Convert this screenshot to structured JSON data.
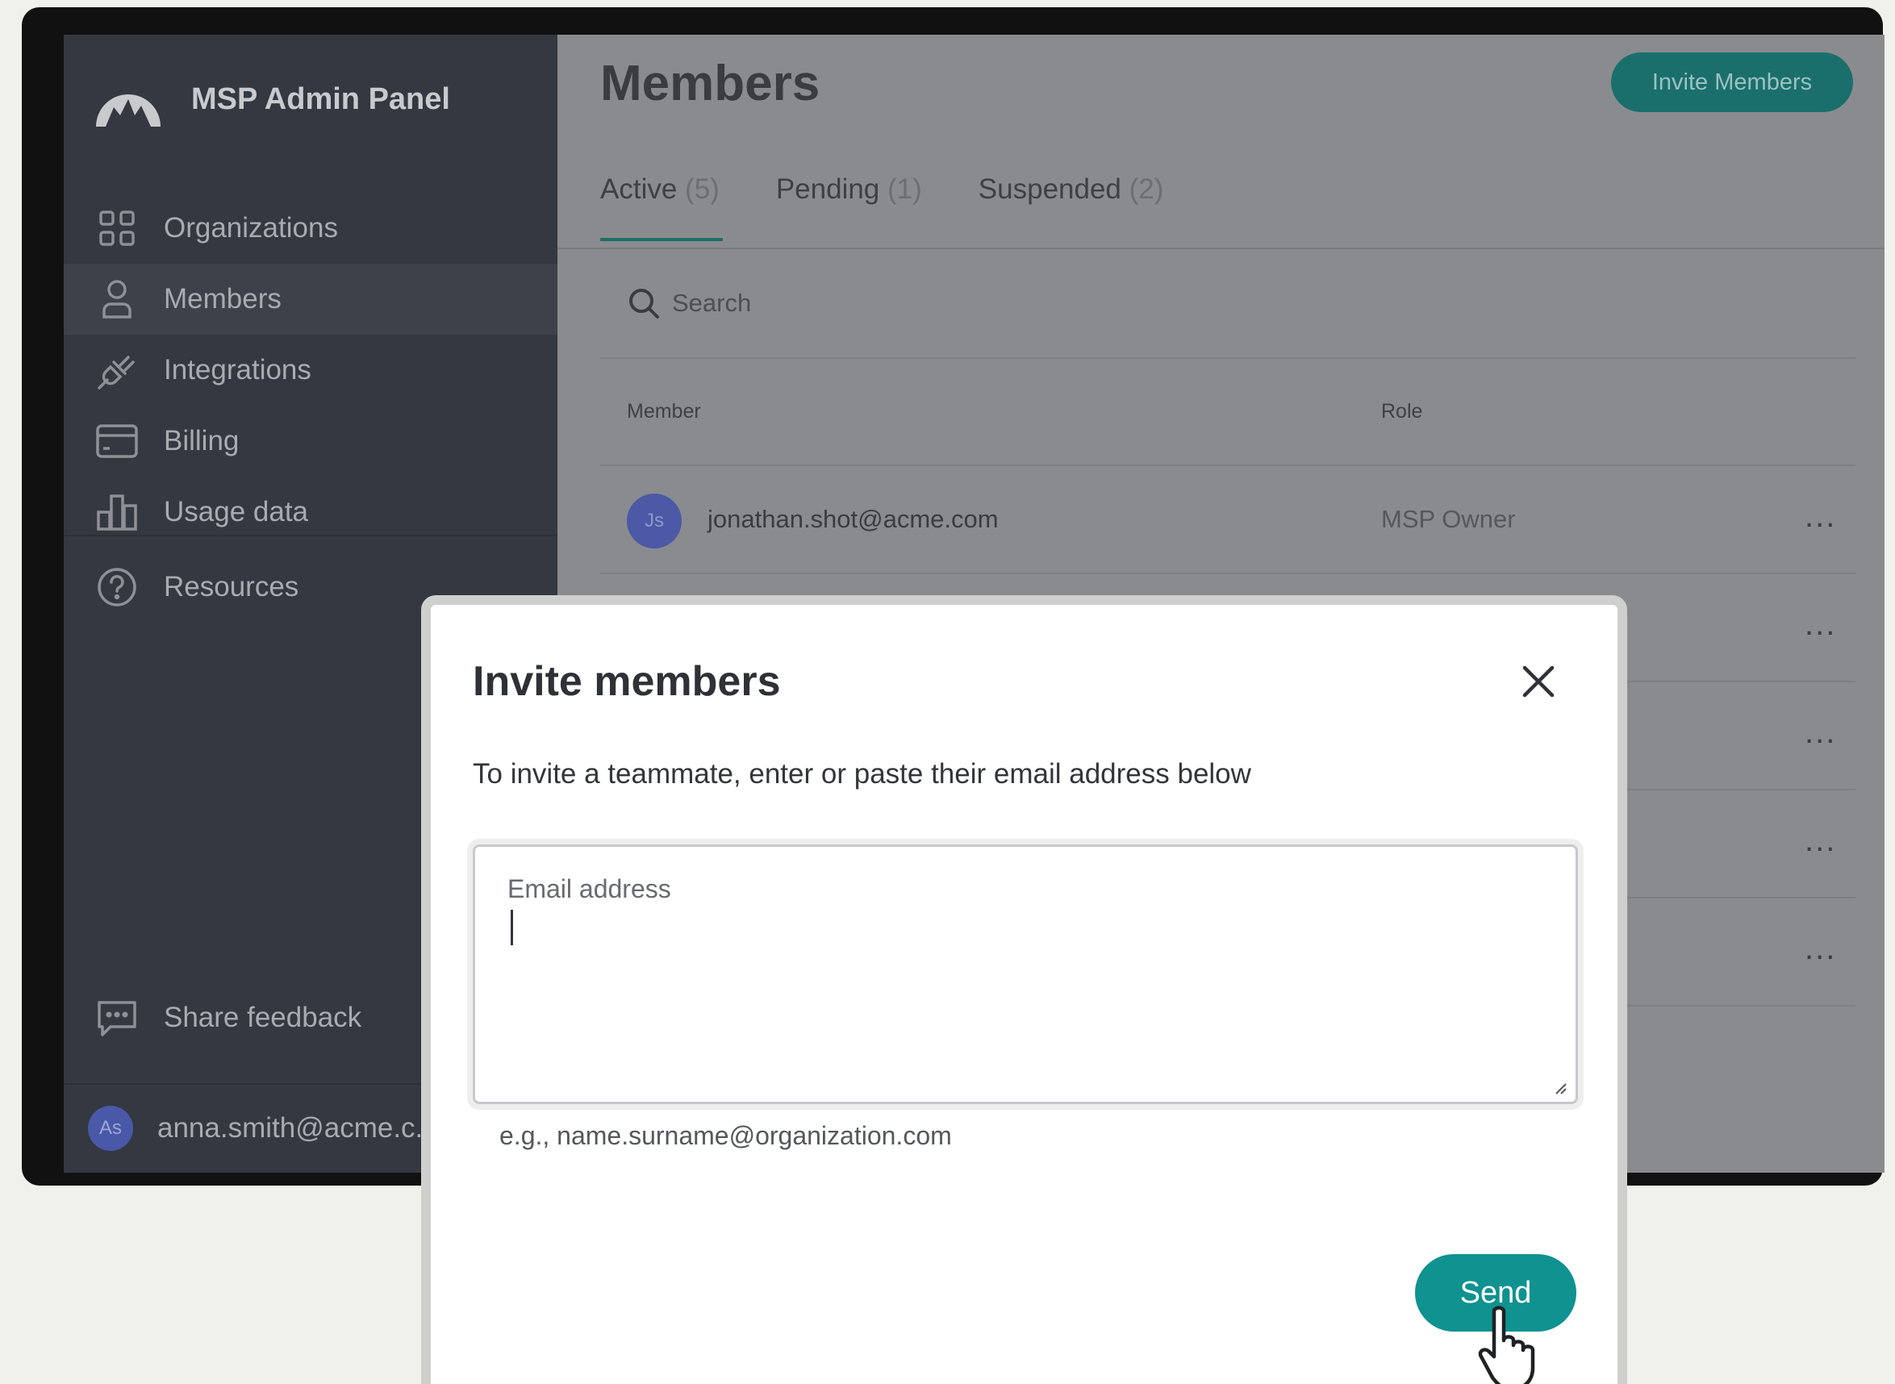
{
  "sidebar": {
    "app_title": "MSP Admin Panel",
    "items": [
      {
        "label": "Organizations",
        "icon": "grid-icon"
      },
      {
        "label": "Members",
        "icon": "person-icon",
        "active": true
      },
      {
        "label": "Integrations",
        "icon": "plug-icon"
      },
      {
        "label": "Billing",
        "icon": "credit-card-icon"
      },
      {
        "label": "Usage data",
        "icon": "bar-chart-icon"
      }
    ],
    "resources": {
      "label": "Resources",
      "icon": "help-circle-icon"
    },
    "feedback": {
      "label": "Share feedback",
      "icon": "chat-bubble-icon"
    },
    "user": {
      "initials": "As",
      "email": "anna.smith@acme.c..."
    }
  },
  "header": {
    "title": "Members",
    "invite_button": "Invite Members"
  },
  "tabs": [
    {
      "label": "Active",
      "count": "(5)",
      "active": true
    },
    {
      "label": "Pending",
      "count": "(1)"
    },
    {
      "label": "Suspended",
      "count": "(2)"
    }
  ],
  "search": {
    "placeholder": "Search"
  },
  "table": {
    "columns": [
      "Member",
      "Role"
    ],
    "rows": [
      {
        "initials": "Js",
        "email": "jonathan.shot@acme.com",
        "role": "MSP Owner",
        "actions": "..."
      },
      {
        "initials": "",
        "email": "",
        "role": "",
        "actions": "..."
      },
      {
        "initials": "",
        "email": "",
        "role": "",
        "actions": "..."
      },
      {
        "initials": "",
        "email": "",
        "role": "",
        "actions": "..."
      },
      {
        "initials": "",
        "email": "",
        "role": "",
        "actions": "..."
      }
    ]
  },
  "modal": {
    "title": "Invite members",
    "description": "To invite a teammate, enter or paste their email address below",
    "email_placeholder": "Email address",
    "email_value": "",
    "hint": "e.g., name.surname@organization.com",
    "send_button": "Send"
  },
  "colors": {
    "accent": "#0f9290",
    "sidebar_bg": "#343841",
    "overlay_bg": "#8a8b8e"
  }
}
